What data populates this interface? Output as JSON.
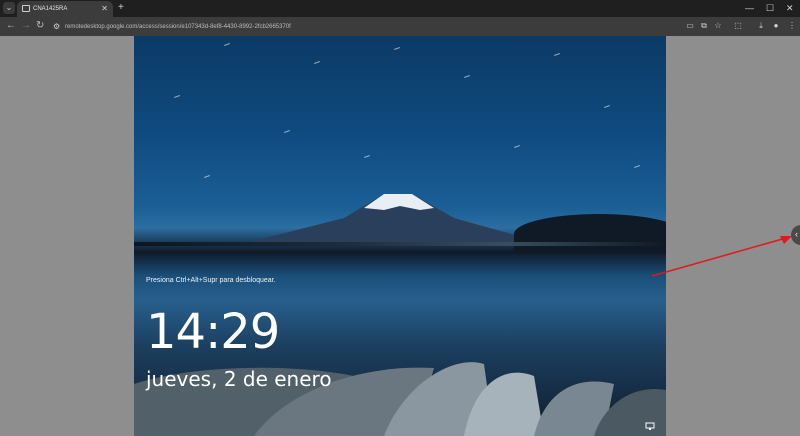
{
  "browser": {
    "tab_menu_icon": "chevron-down-icon",
    "tab_title": "CNA1425RA",
    "tab_close": "✕",
    "new_tab": "+",
    "window_controls": {
      "minimize": "—",
      "maximize": "☐",
      "close": "✕"
    },
    "nav": {
      "back": "←",
      "forward": "→",
      "reload": "↻"
    },
    "url": "remotedesktop.google.com/access/session/e107343d-8ef8-4430-8992-2fcb2665370f",
    "toolbar_icons": [
      "bookmark-icon",
      "cast-icon",
      "star-icon",
      "extensions-icon",
      "download-icon",
      "profile-icon",
      "menu-icon"
    ]
  },
  "lockscreen": {
    "hint": "Presiona Ctrl+Alt+Supr para desbloquear.",
    "time": "14:29",
    "date": "jueves, 2 de enero"
  },
  "session_panel": {
    "handle_glyph": "‹"
  },
  "colors": {
    "arrow": "#e0191b"
  }
}
